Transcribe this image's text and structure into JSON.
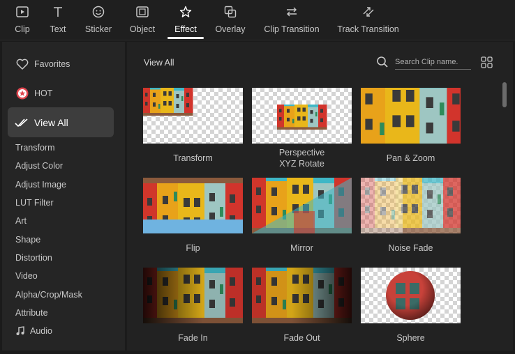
{
  "toolbar": {
    "items": [
      {
        "label": "Clip",
        "icon": "clip-icon"
      },
      {
        "label": "Text",
        "icon": "text-icon"
      },
      {
        "label": "Sticker",
        "icon": "sticker-icon"
      },
      {
        "label": "Object",
        "icon": "object-icon"
      },
      {
        "label": "Effect",
        "icon": "effect-icon",
        "active": true
      },
      {
        "label": "Overlay",
        "icon": "overlay-icon"
      },
      {
        "label": "Clip Transition",
        "icon": "clip-transition-icon"
      },
      {
        "label": "Track Transition",
        "icon": "track-transition-icon"
      }
    ]
  },
  "sidebar": {
    "favorites": "Favorites",
    "hot": "HOT",
    "view_all": "View All",
    "categories": [
      "Transform",
      "Adjust Color",
      "Adjust Image",
      "LUT Filter",
      "Art",
      "Shape",
      "Distortion",
      "Video",
      "Alpha/Crop/Mask",
      "Attribute",
      "Audio"
    ]
  },
  "main": {
    "title": "View All",
    "search_placeholder": "Search Clip name.",
    "effects": [
      {
        "label": "Transform"
      },
      {
        "label1": "Perspective",
        "label2": "XYZ Rotate"
      },
      {
        "label": "Pan & Zoom"
      },
      {
        "label": "Flip"
      },
      {
        "label": "Mirror"
      },
      {
        "label": "Noise Fade"
      },
      {
        "label": "Fade In"
      },
      {
        "label": "Fade Out"
      },
      {
        "label": "Sphere"
      }
    ]
  },
  "colors": {
    "background": "#1b1b1b",
    "sidebar": "#252525",
    "active_item": "#3d3d3d",
    "hot_badge": "#e0464f"
  }
}
